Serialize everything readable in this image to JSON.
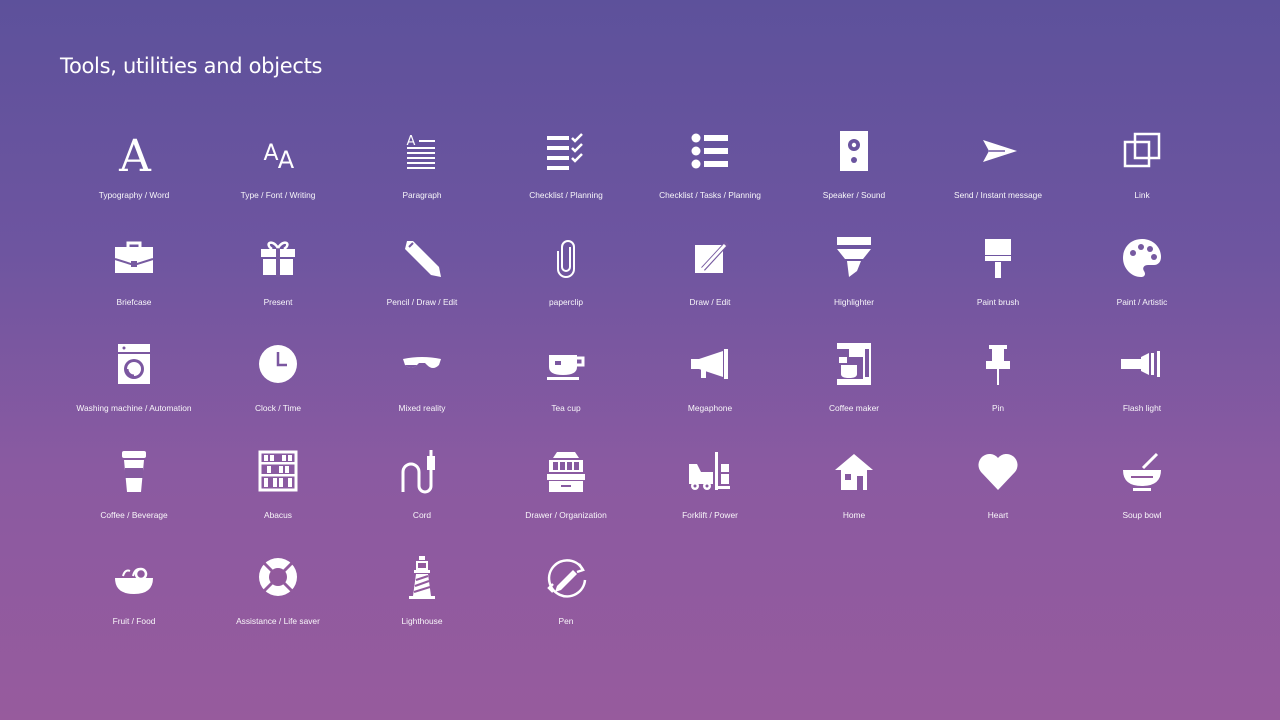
{
  "title": "Tools, utilities  and objects",
  "items": [
    {
      "label": "Typography / Word",
      "icon": "typography"
    },
    {
      "label": "Type / Font / Writing",
      "icon": "font"
    },
    {
      "label": "Paragraph",
      "icon": "paragraph"
    },
    {
      "label": "Checklist / Planning",
      "icon": "checklist"
    },
    {
      "label": "Checklist / Tasks / Planning",
      "icon": "bullet-list"
    },
    {
      "label": "Speaker / Sound",
      "icon": "speaker"
    },
    {
      "label": "Send / Instant message",
      "icon": "send"
    },
    {
      "label": "Link",
      "icon": "link"
    },
    {
      "label": "Briefcase",
      "icon": "briefcase"
    },
    {
      "label": "Present",
      "icon": "present"
    },
    {
      "label": "Pencil / Draw / Edit",
      "icon": "pencil"
    },
    {
      "label": "paperclip",
      "icon": "paperclip"
    },
    {
      "label": "Draw / Edit",
      "icon": "draw-edit"
    },
    {
      "label": "Highlighter",
      "icon": "highlighter"
    },
    {
      "label": "Paint brush",
      "icon": "paint-brush"
    },
    {
      "label": "Paint / Artistic",
      "icon": "palette"
    },
    {
      "label": "Washing machine / Automation",
      "icon": "washing-machine"
    },
    {
      "label": "Clock / Time",
      "icon": "clock"
    },
    {
      "label": "Mixed reality",
      "icon": "mixed-reality"
    },
    {
      "label": "Tea cup",
      "icon": "tea-cup"
    },
    {
      "label": "Megaphone",
      "icon": "megaphone"
    },
    {
      "label": "Coffee maker",
      "icon": "coffee-maker"
    },
    {
      "label": "Pin",
      "icon": "pin"
    },
    {
      "label": "Flash light",
      "icon": "flashlight"
    },
    {
      "label": "Coffee / Beverage",
      "icon": "coffee-cup"
    },
    {
      "label": "Abacus",
      "icon": "abacus"
    },
    {
      "label": "Cord",
      "icon": "cord"
    },
    {
      "label": "Drawer / Organization",
      "icon": "drawer"
    },
    {
      "label": "Forklift / Power",
      "icon": "forklift"
    },
    {
      "label": "Home",
      "icon": "home"
    },
    {
      "label": "Heart",
      "icon": "heart"
    },
    {
      "label": "Soup bowl",
      "icon": "soup-bowl"
    },
    {
      "label": "Fruit / Food",
      "icon": "fruit-bowl"
    },
    {
      "label": "Assistance / Life saver",
      "icon": "life-saver"
    },
    {
      "label": "Lighthouse",
      "icon": "lighthouse"
    },
    {
      "label": "Pen",
      "icon": "pen"
    }
  ]
}
